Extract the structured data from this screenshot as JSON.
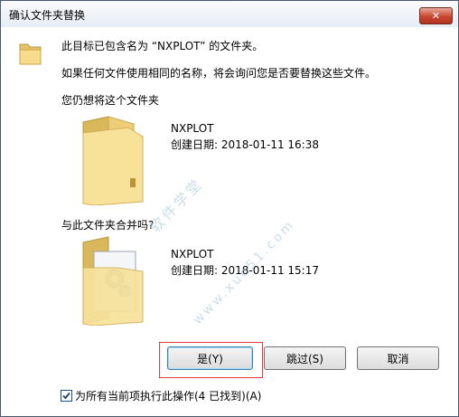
{
  "window": {
    "title": "确认文件夹替换",
    "close_label": "✕"
  },
  "message": {
    "line1": "此目标已包含名为 “NXPLOT” 的文件夹。",
    "line2": "如果任何文件使用相同的名称，将会询问您是否要替换这些文件。",
    "line3": "您仍想将这个文件夹"
  },
  "existing_folder": {
    "name": "NXPLOT",
    "created": "创建日期: 2018-01-11 16:38"
  },
  "merge_question": "与此文件夹合并吗?",
  "incoming_folder": {
    "name": "NXPLOT",
    "created": "创建日期: 2018-01-11 15:17"
  },
  "buttons": {
    "yes": "是(Y)",
    "skip": "跳过(S)",
    "cancel": "取消"
  },
  "checkbox": {
    "label": "为所有当前项执行此操作(4 已找到)(A)",
    "checked": true
  },
  "watermark": {
    "text1": "软件学堂",
    "text2": "www.xue51.com"
  }
}
